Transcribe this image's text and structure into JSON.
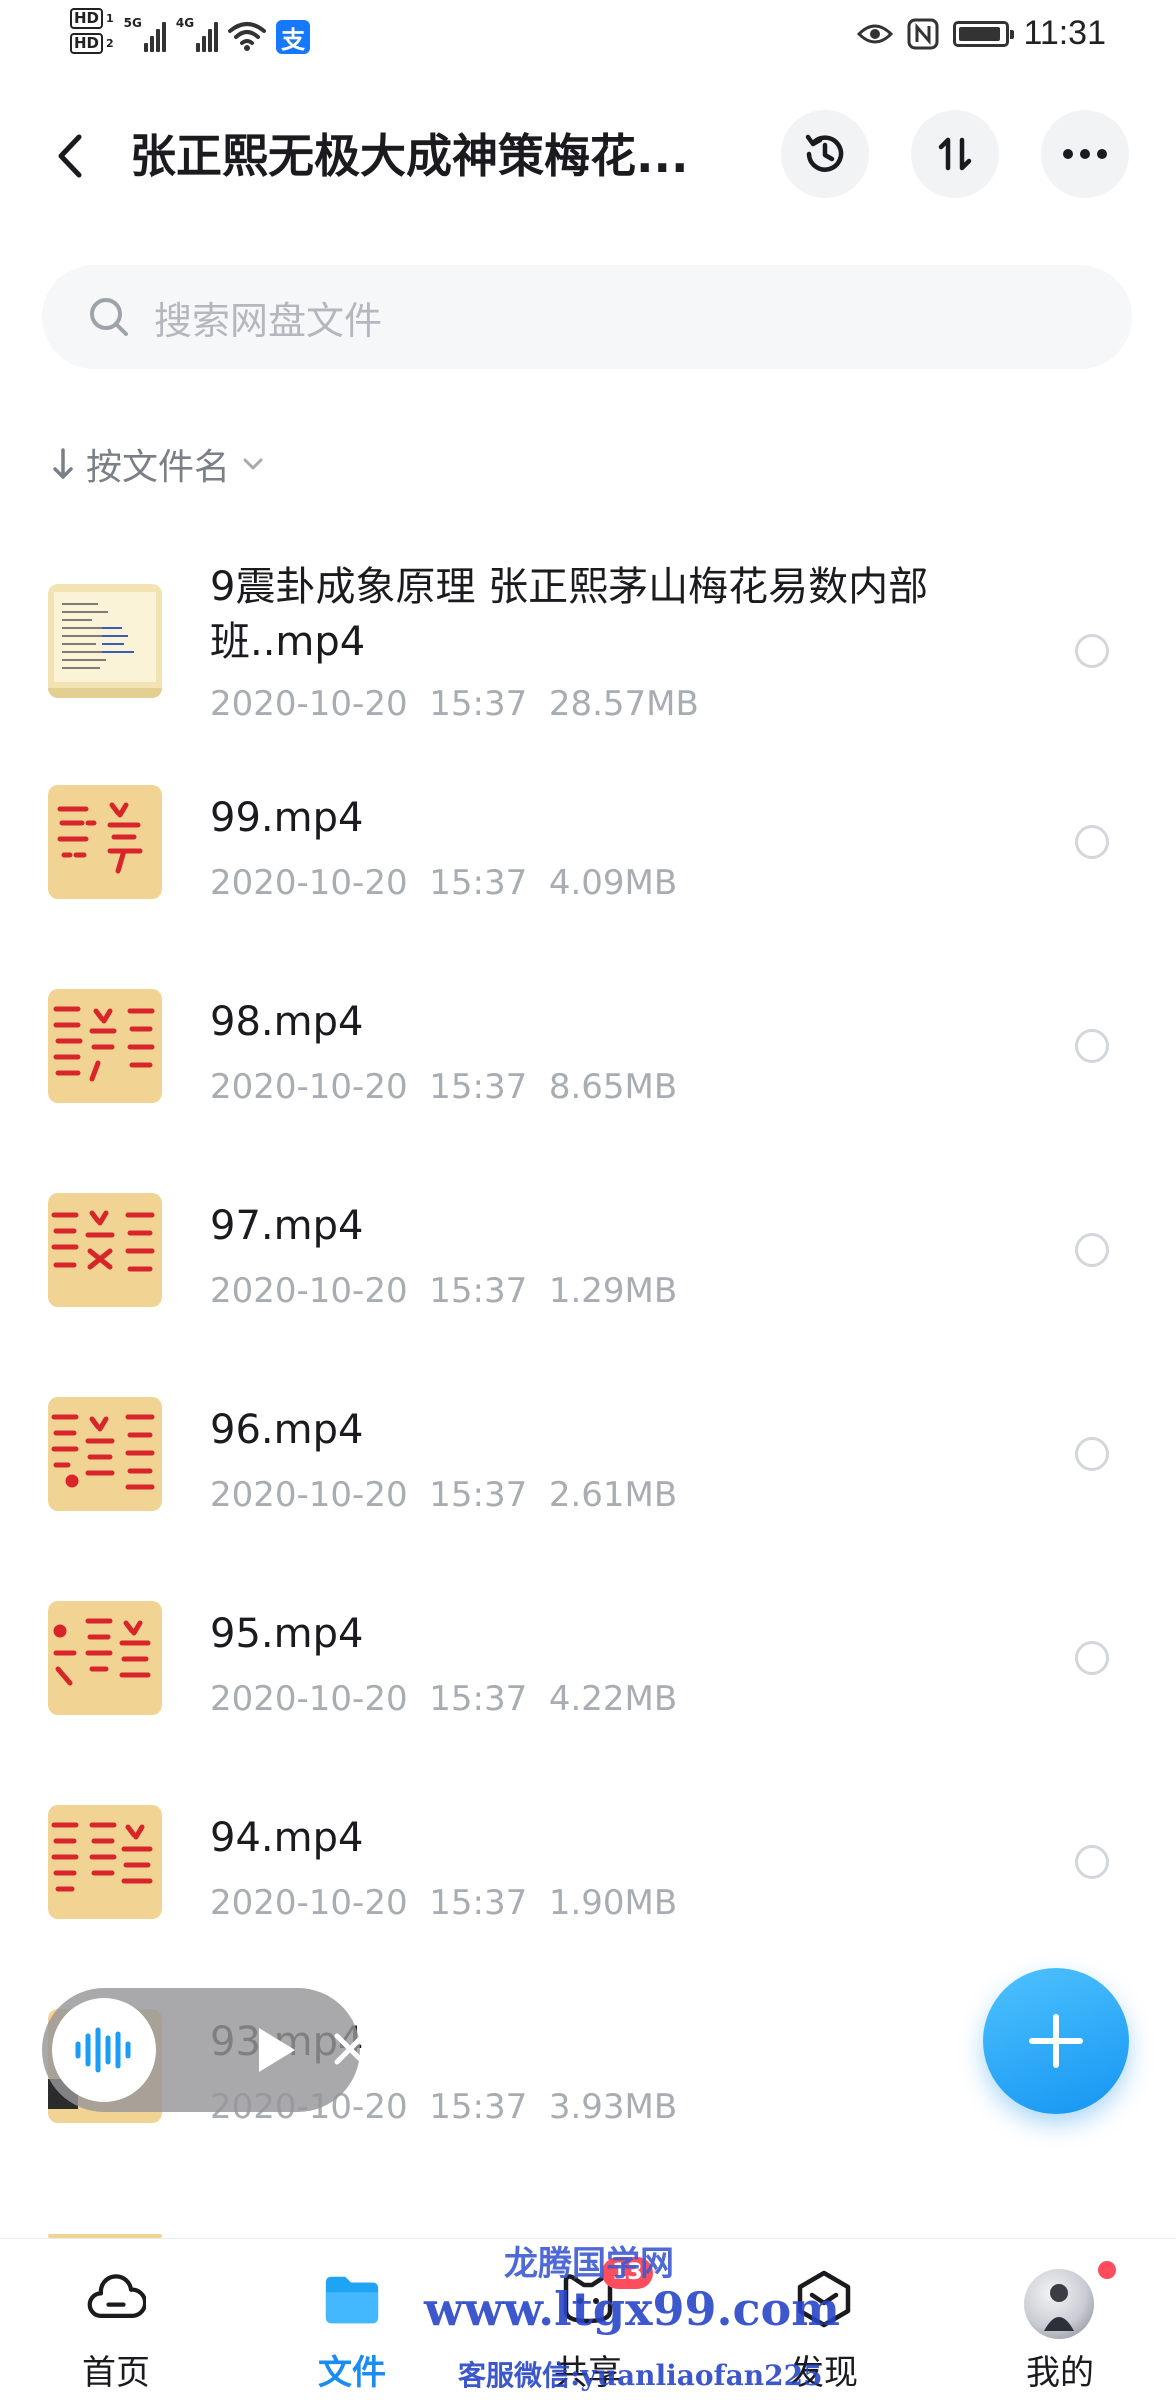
{
  "status_bar": {
    "hd1": "HD",
    "hd1_sub": "1",
    "hd2": "HD",
    "hd2_sub": "2",
    "net1": "5G",
    "net2": "4G",
    "alipay_glyph": "支",
    "time": "11:31",
    "battery_level": 0.92
  },
  "header": {
    "title": "张正熙无极大成神策梅花..."
  },
  "search": {
    "placeholder": "搜索网盘文件"
  },
  "sort": {
    "label": "按文件名"
  },
  "files": [
    {
      "name": "9震卦成象原理 张正熙茅山梅花易数内部班..mp4",
      "date": "2020-10-20",
      "time": "15:37",
      "size": "28.57MB",
      "thumb": "doc"
    },
    {
      "name": "99.mp4",
      "date": "2020-10-20",
      "time": "15:37",
      "size": "4.09MB",
      "thumb": "calligraphy"
    },
    {
      "name": "98.mp4",
      "date": "2020-10-20",
      "time": "15:37",
      "size": "8.65MB",
      "thumb": "calligraphy"
    },
    {
      "name": "97.mp4",
      "date": "2020-10-20",
      "time": "15:37",
      "size": "1.29MB",
      "thumb": "calligraphy"
    },
    {
      "name": "96.mp4",
      "date": "2020-10-20",
      "time": "15:37",
      "size": "2.61MB",
      "thumb": "calligraphy"
    },
    {
      "name": "95.mp4",
      "date": "2020-10-20",
      "time": "15:37",
      "size": "4.22MB",
      "thumb": "calligraphy"
    },
    {
      "name": "94.mp4",
      "date": "2020-10-20",
      "time": "15:37",
      "size": "1.90MB",
      "thumb": "calligraphy"
    },
    {
      "name": "93.mp4",
      "date": "2020-10-20",
      "time": "15:37",
      "size": "3.93MB",
      "thumb": "calligraphy"
    }
  ],
  "nav": {
    "items": [
      {
        "label": "首页",
        "icon": "cloud-icon",
        "active": false
      },
      {
        "label": "文件",
        "icon": "folder-icon",
        "active": true
      },
      {
        "label": "共享",
        "icon": "share-icon",
        "active": false
      },
      {
        "label": "发现",
        "icon": "discover-icon",
        "active": false
      },
      {
        "label": "我的",
        "icon": "avatar",
        "active": false
      }
    ],
    "share_badge": "13"
  },
  "watermark": {
    "line1": "龙腾国学网",
    "line2": "www.ltgx99.com",
    "line3": "客服微信:yuanliaofan225"
  },
  "colors": {
    "accent": "#1a8cf2",
    "fab": "#1595f2",
    "badge": "#ff4d5e",
    "thumb_bg": "#f1d394",
    "thumb_stroke": "#d8252a"
  }
}
